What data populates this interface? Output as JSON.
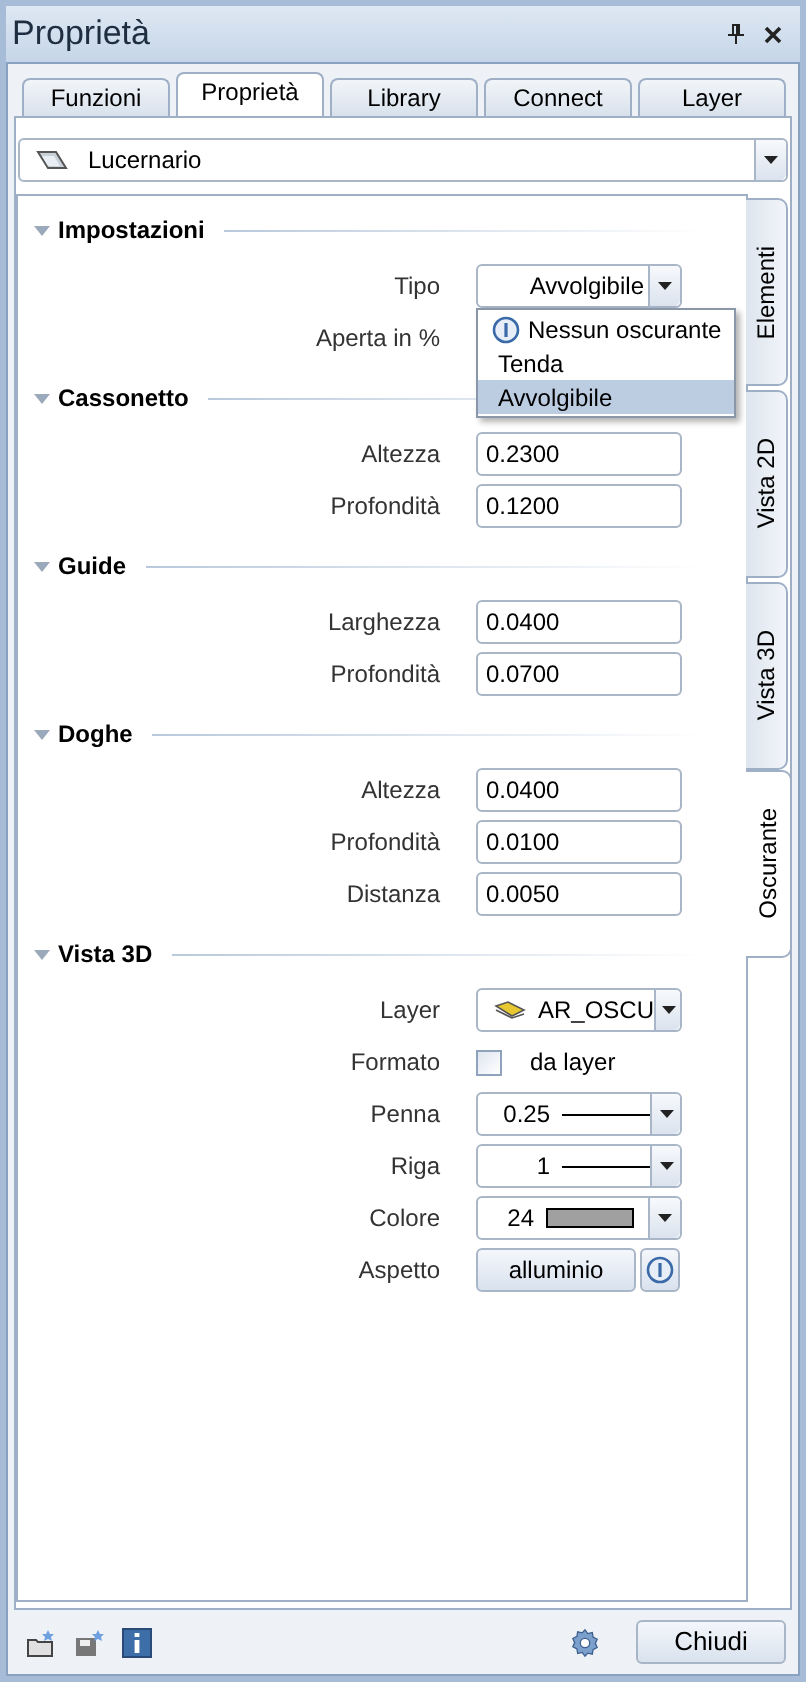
{
  "window": {
    "title": "Proprietà"
  },
  "tabs": [
    {
      "label": "Funzioni",
      "selected": false
    },
    {
      "label": "Proprietà",
      "selected": true
    },
    {
      "label": "Library",
      "selected": false
    },
    {
      "label": "Connect",
      "selected": false
    },
    {
      "label": "Layer",
      "selected": false
    }
  ],
  "object_selector": {
    "value": "Lucernario"
  },
  "side_tabs": [
    {
      "label": "Elementi",
      "selected": false
    },
    {
      "label": "Vista 2D",
      "selected": false
    },
    {
      "label": "Vista 3D",
      "selected": false
    },
    {
      "label": "Oscurante",
      "selected": true
    }
  ],
  "sections": [
    {
      "title": "Impostazioni",
      "expanded": true,
      "rows": [
        {
          "kind": "select",
          "label": "Tipo",
          "value": "Avvolgibile",
          "expanded": true,
          "options": [
            {
              "label": "Nessun oscurante",
              "info": true,
              "selected": false
            },
            {
              "label": "Tenda",
              "info": false,
              "selected": false
            },
            {
              "label": "Avvolgibile",
              "info": false,
              "selected": true
            }
          ]
        },
        {
          "kind": "covered",
          "label": "Aperta in %"
        }
      ]
    },
    {
      "title": "Cassonetto",
      "expanded": true,
      "rows": [
        {
          "kind": "input",
          "label": "Altezza",
          "value": "0.2300"
        },
        {
          "kind": "input",
          "label": "Profondità",
          "value": "0.1200"
        }
      ]
    },
    {
      "title": "Guide",
      "expanded": true,
      "rows": [
        {
          "kind": "input",
          "label": "Larghezza",
          "value": "0.0400"
        },
        {
          "kind": "input",
          "label": "Profondità",
          "value": "0.0700"
        }
      ]
    },
    {
      "title": "Doghe",
      "expanded": true,
      "rows": [
        {
          "kind": "input",
          "label": "Altezza",
          "value": "0.0400"
        },
        {
          "kind": "input",
          "label": "Profondità",
          "value": "0.0100"
        },
        {
          "kind": "input",
          "label": "Distanza",
          "value": "0.0050"
        }
      ]
    },
    {
      "title": "Vista 3D",
      "expanded": true,
      "rows": [
        {
          "kind": "layer",
          "label": "Layer",
          "value": "AR_OSCU"
        },
        {
          "kind": "checkbox",
          "label": "Formato",
          "value": "da layer",
          "checked": false
        },
        {
          "kind": "line",
          "label": "Penna",
          "value": "0.25"
        },
        {
          "kind": "line",
          "label": "Riga",
          "value": "1"
        },
        {
          "kind": "color",
          "label": "Colore",
          "value": "24",
          "color": "#a0a0a0"
        },
        {
          "kind": "button",
          "label": "Aspetto",
          "value": "alluminio"
        }
      ]
    }
  ],
  "footer": {
    "close_button": "Chiudi"
  }
}
